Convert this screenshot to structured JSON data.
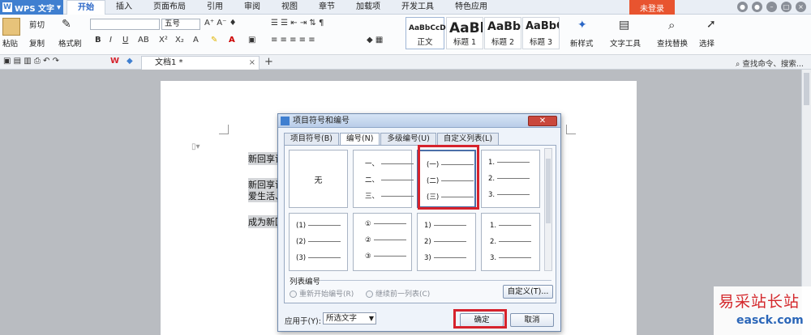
{
  "app": {
    "title": "WPS 文字"
  },
  "menu": [
    "开始",
    "插入",
    "页面布局",
    "引用",
    "审阅",
    "视图",
    "章节",
    "加载项",
    "开发工具",
    "特色应用"
  ],
  "menu_active": "开始",
  "login_label": "未登录",
  "ribbon": {
    "paste": "粘贴",
    "cut": "剪切",
    "copy": "复制",
    "format_painter": "格式刷",
    "font_size": "五号",
    "styles": [
      {
        "sample": "AaBbCcDd",
        "name": "正文"
      },
      {
        "sample": "AaBl",
        "name": "标题 1"
      },
      {
        "sample": "AaBbC",
        "name": "标题 2"
      },
      {
        "sample": "AaBbC",
        "name": "标题 3"
      }
    ],
    "new_style": "新样式",
    "text_tools": "文字工具",
    "find_replace": "查找替换",
    "select": "选择"
  },
  "tabbar": {
    "doc_tab": "文档1 *",
    "search": "查找命令、搜索..."
  },
  "document": {
    "lines": [
      "新回享计",
      "新回享计",
      "爱生活、",
      "成为新回"
    ]
  },
  "dialog": {
    "title": "项目符号和编号",
    "close": "关闭",
    "tabs": [
      "项目符号(B)",
      "编号(N)",
      "多级编号(U)",
      "自定义列表(L)"
    ],
    "active_tab": "编号(N)",
    "none_label": "无",
    "row1": {
      "chinese": [
        "一、",
        "二、",
        "三、"
      ],
      "paren_chinese": [
        "(一)",
        "(二)",
        "(三)"
      ],
      "arabic_dot": [
        "1.",
        "2.",
        "3."
      ]
    },
    "row2": {
      "paren_arabic": [
        "(1)",
        "(2)",
        "(3)"
      ],
      "circled": [
        "①",
        "②",
        "③"
      ],
      "arabic_paren": [
        "1)",
        "2)",
        "3)"
      ],
      "arabic_dot": [
        "1.",
        "2.",
        "3."
      ]
    },
    "list_numbering_label": "列表编号",
    "restart": "重新开始编号(R)",
    "continue": "继续前一列表(C)",
    "customize": "自定义(T)...",
    "apply_to_label": "应用于(Y):",
    "apply_to_value": "所选文字",
    "ok": "确定",
    "cancel": "取消"
  },
  "watermark": {
    "cn": "易采站长站",
    "en": "easck.com"
  }
}
